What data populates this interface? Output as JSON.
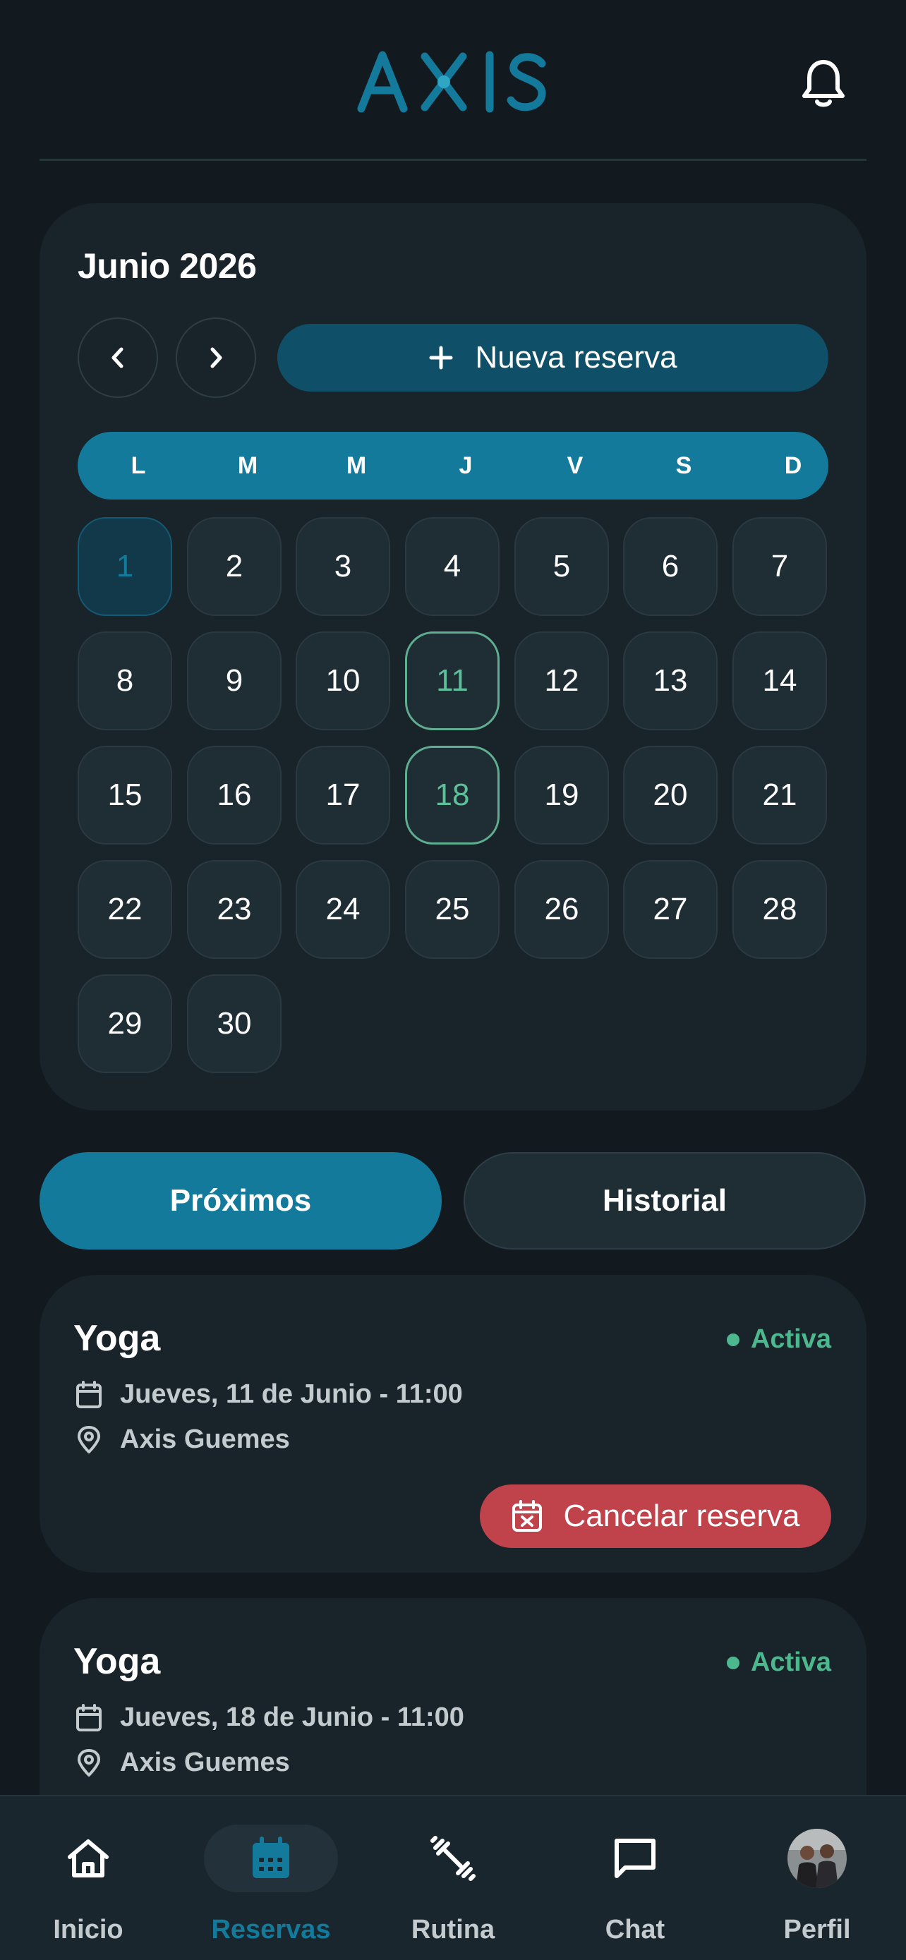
{
  "header": {
    "brand": "AXIS",
    "notifications_icon": "bell-icon"
  },
  "colors": {
    "background": "#121a1f",
    "card": "#18232a",
    "accent": "#137a9c",
    "accent_dark": "#0f5068",
    "success": "#4db88e",
    "danger": "#c0424a"
  },
  "calendar": {
    "month_title": "Junio 2026",
    "prev_icon": "chevron-left-icon",
    "next_icon": "chevron-right-icon",
    "new_booking_label": "Nueva reserva",
    "new_booking_icon": "plus-icon",
    "weekdays": [
      "L",
      "M",
      "M",
      "J",
      "V",
      "S",
      "D"
    ],
    "days": [
      "1",
      "2",
      "3",
      "4",
      "5",
      "6",
      "7",
      "8",
      "9",
      "10",
      "11",
      "12",
      "13",
      "14",
      "15",
      "16",
      "17",
      "18",
      "19",
      "20",
      "21",
      "22",
      "23",
      "24",
      "25",
      "26",
      "27",
      "28",
      "29",
      "30"
    ],
    "today": "1",
    "booked_days": [
      "11",
      "18"
    ]
  },
  "tabs": {
    "upcoming": "Próximos",
    "history": "Historial",
    "selected": "Próximos"
  },
  "bookings": [
    {
      "title": "Yoga",
      "status": "Activa",
      "date": "Jueves, 11 de Junio - 11:00",
      "location": "Axis Guemes",
      "cancel_label": "Cancelar reserva"
    },
    {
      "title": "Yoga",
      "status": "Activa",
      "date": "Jueves, 18 de Junio - 11:00",
      "location": "Axis Guemes"
    }
  ],
  "bottom_nav": {
    "items": [
      {
        "label": "Inicio",
        "icon": "home-icon"
      },
      {
        "label": "Reservas",
        "icon": "calendar-icon"
      },
      {
        "label": "Rutina",
        "icon": "dumbbell-icon"
      },
      {
        "label": "Chat",
        "icon": "chat-icon"
      },
      {
        "label": "Perfil",
        "icon": "avatar"
      }
    ],
    "active": "Reservas"
  }
}
